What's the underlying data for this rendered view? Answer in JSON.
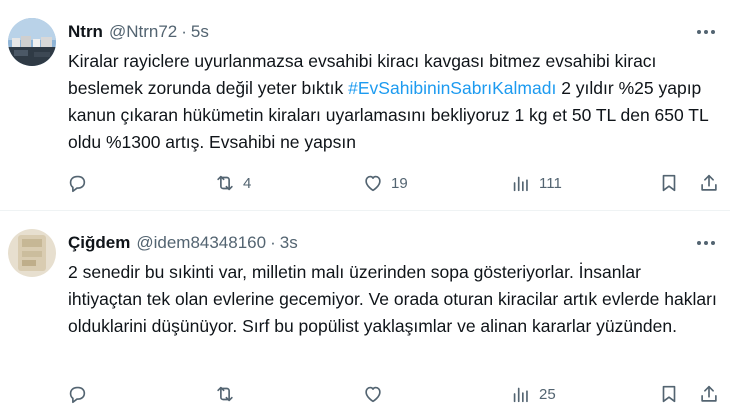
{
  "tweets": [
    {
      "name": "Ntrn",
      "handle": "@Ntrn72",
      "separator": "·",
      "time": "5s",
      "text_before": "Kiralar rayiclere uyurlanmazsa evsahibi kiracı kavgası bitmez evsahibi kiracı beslemek zorunda değil yeter bıktık ",
      "hashtag": "#EvSahibininSabrıKalmadı",
      "text_after": " 2 yıldır %25 yapıp kanun çıkaran hükümetin kiraları uyarlamasını bekliyoruz 1 kg et 50 TL den 650 TL oldu %1300 artış. Evsahibi ne yapsın",
      "reply_count": "",
      "retweet_count": "4",
      "like_count": "19",
      "view_count": "111"
    },
    {
      "name": "Çiğdem",
      "handle": "@idem84348160",
      "separator": "·",
      "time": "3s",
      "text": "2 senedir bu sıkinti var, milletin malı üzerinden sopa gösteriyorlar. İnsanlar ihtiyaçtan tek olan evlerine gecemiyor. Ve orada oturan kiracilar artık evlerde hakları olduklarini düşünüyor. Sırf bu popülist yaklaşımlar ve alinan kararlar yüzünden.",
      "reply_count": "",
      "retweet_count": "",
      "like_count": "",
      "view_count": "25"
    }
  ],
  "icons": {
    "reply": "reply-icon",
    "retweet": "retweet-icon",
    "like": "like-icon",
    "views": "views-icon",
    "bookmark": "bookmark-icon",
    "share": "share-icon",
    "more": "more-icon"
  },
  "colors": {
    "hashtag": "#1d9bf0",
    "secondary_text": "#536471",
    "primary_text": "#0f1419"
  }
}
